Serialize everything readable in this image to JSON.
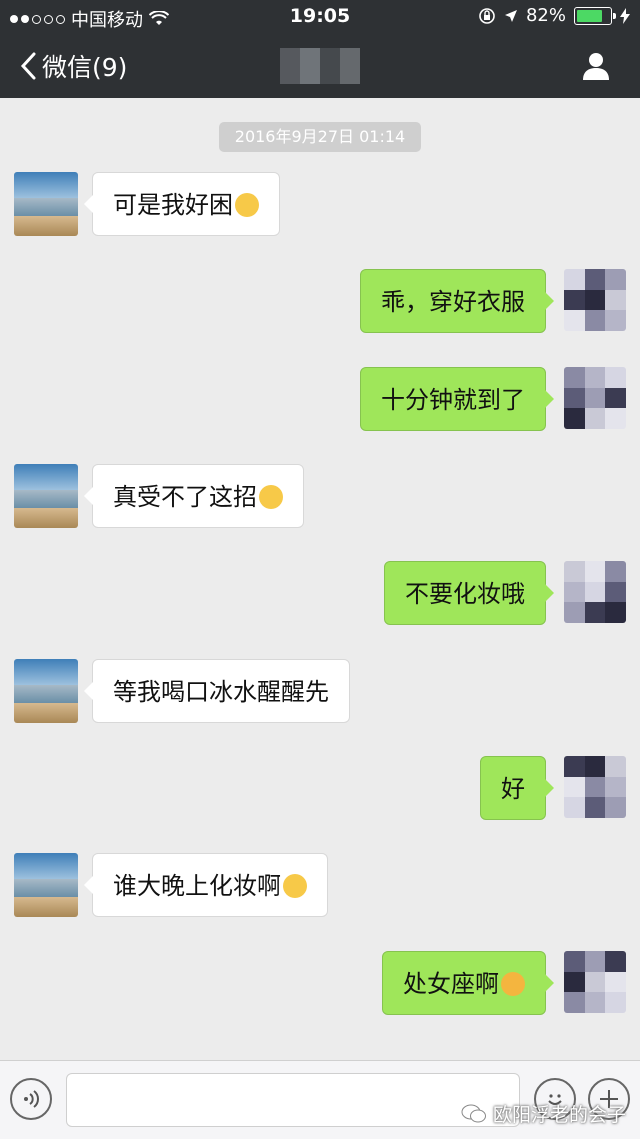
{
  "status_bar": {
    "carrier": "中国移动",
    "time": "19:05",
    "battery": "82%",
    "battery_level": 0.82
  },
  "nav": {
    "back_label": "微信(9)"
  },
  "chat": {
    "timestamp": "2016年9月27日 01:14",
    "messages": [
      {
        "side": "in",
        "text": "可是我好困"
      },
      {
        "side": "out",
        "text": "乖，穿好衣服"
      },
      {
        "side": "out",
        "text": "十分钟就到了"
      },
      {
        "side": "in",
        "text": "真受不了这招"
      },
      {
        "side": "out",
        "text": "不要化妆哦"
      },
      {
        "side": "in",
        "text": "等我喝口冰水醒醒先"
      },
      {
        "side": "out",
        "text": "好"
      },
      {
        "side": "in",
        "text": "谁大晚上化妆啊"
      },
      {
        "side": "out",
        "text": "处女座啊"
      }
    ]
  },
  "watermark": {
    "text": "欧阳浮老的会子"
  },
  "icons": {
    "back": "chevron-left-icon",
    "contact": "person-icon",
    "voice": "voice-icon",
    "emoji": "emoji-icon",
    "more": "plus-icon"
  },
  "colors": {
    "nav_bg": "#2e3134",
    "chat_bg": "#ececec",
    "outgoing_bubble": "#9fe65a",
    "incoming_bubble": "#ffffff"
  }
}
